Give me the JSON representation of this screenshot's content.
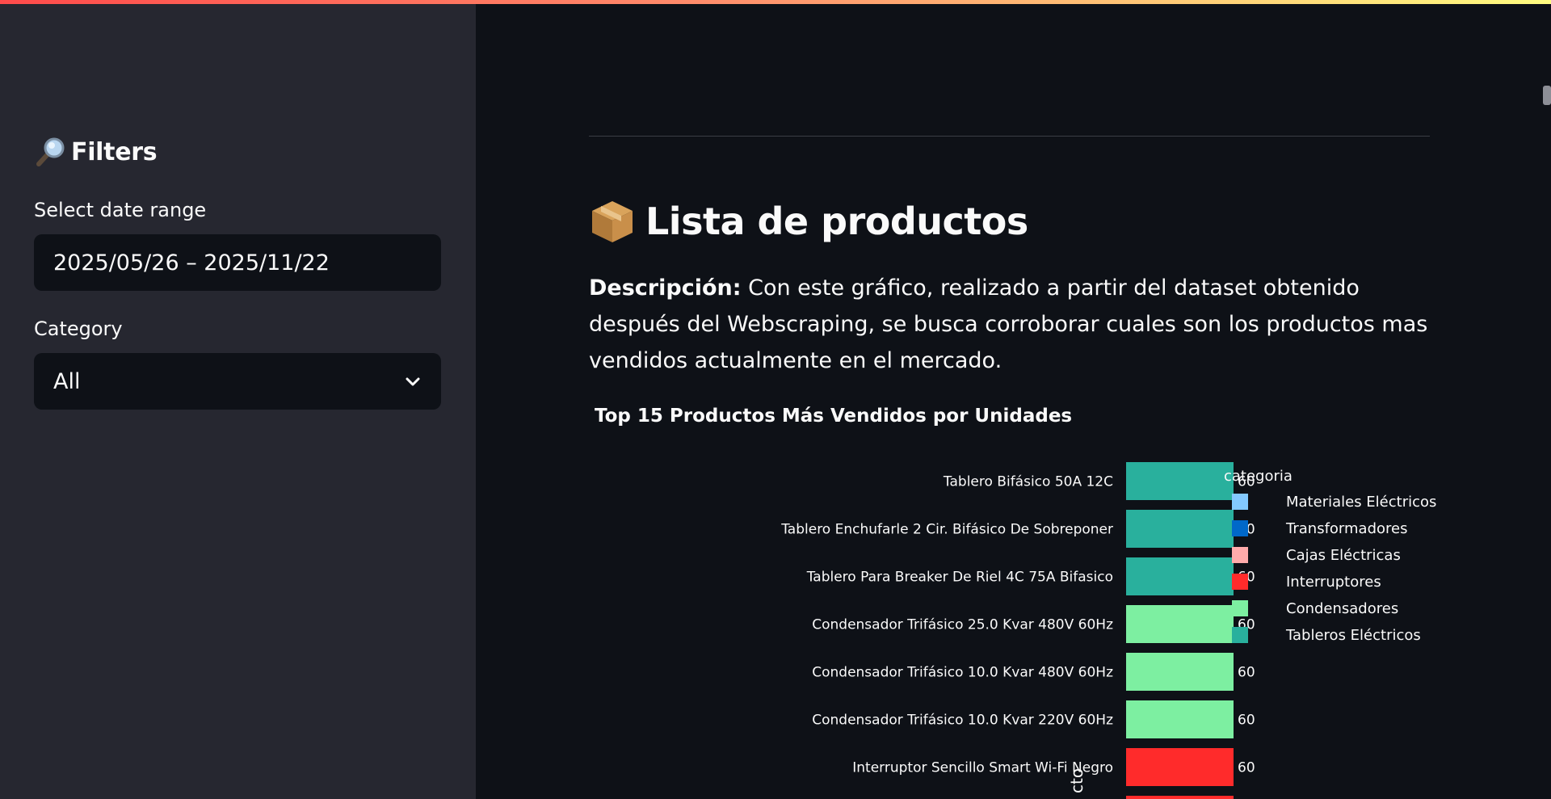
{
  "sidebar": {
    "filters_title": "Filters",
    "date_label": "Select date range",
    "date_value": "2025/05/26 – 2025/11/22",
    "category_label": "Category",
    "category_value": "All"
  },
  "main": {
    "section_title": "Lista de productos",
    "desc_bold": "Descripción:",
    "desc_text": " Con este gráfico, realizado a partir del dataset obtenido después del Webscraping, se busca corroborar cuales son los productos mas vendidos actualmente en el mercado."
  },
  "chart_data": {
    "type": "bar",
    "orientation": "horizontal",
    "title": "Top 15 Productos Más Vendidos por Unidades",
    "ylabel": "cto",
    "legend_title": "categoria",
    "legend": [
      {
        "name": "Materiales Eléctricos",
        "color": "#83c9ff"
      },
      {
        "name": "Transformadores",
        "color": "#0068c9"
      },
      {
        "name": "Cajas Eléctricas",
        "color": "#ffabab"
      },
      {
        "name": "Interruptores",
        "color": "#ff2b2b"
      },
      {
        "name": "Condensadores",
        "color": "#7defa1"
      },
      {
        "name": "Tableros Eléctricos",
        "color": "#29b09d"
      }
    ],
    "bars": [
      {
        "label": "Tablero Bifásico 50A 12C",
        "value": 60,
        "category": "Tableros Eléctricos"
      },
      {
        "label": "Tablero Enchufarle 2 Cir. Bifásico De Sobreponer",
        "value": 60,
        "category": "Tableros Eléctricos"
      },
      {
        "label": "Tablero Para Breaker De Riel 4C 75A Bifasico",
        "value": 60,
        "category": "Tableros Eléctricos"
      },
      {
        "label": "Condensador Trifásico 25.0 Kvar 480V 60Hz",
        "value": 60,
        "category": "Condensadores"
      },
      {
        "label": "Condensador Trifásico 10.0 Kvar 480V 60Hz",
        "value": 60,
        "category": "Condensadores"
      },
      {
        "label": "Condensador Trifásico 10.0 Kvar 220V 60Hz",
        "value": 60,
        "category": "Condensadores"
      },
      {
        "label": "Interruptor Sencillo Smart Wi-Fi Negro",
        "value": 60,
        "category": "Interruptores"
      },
      {
        "label": "",
        "value": 60,
        "category": "Interruptores"
      }
    ],
    "xlim": [
      0,
      60
    ]
  }
}
